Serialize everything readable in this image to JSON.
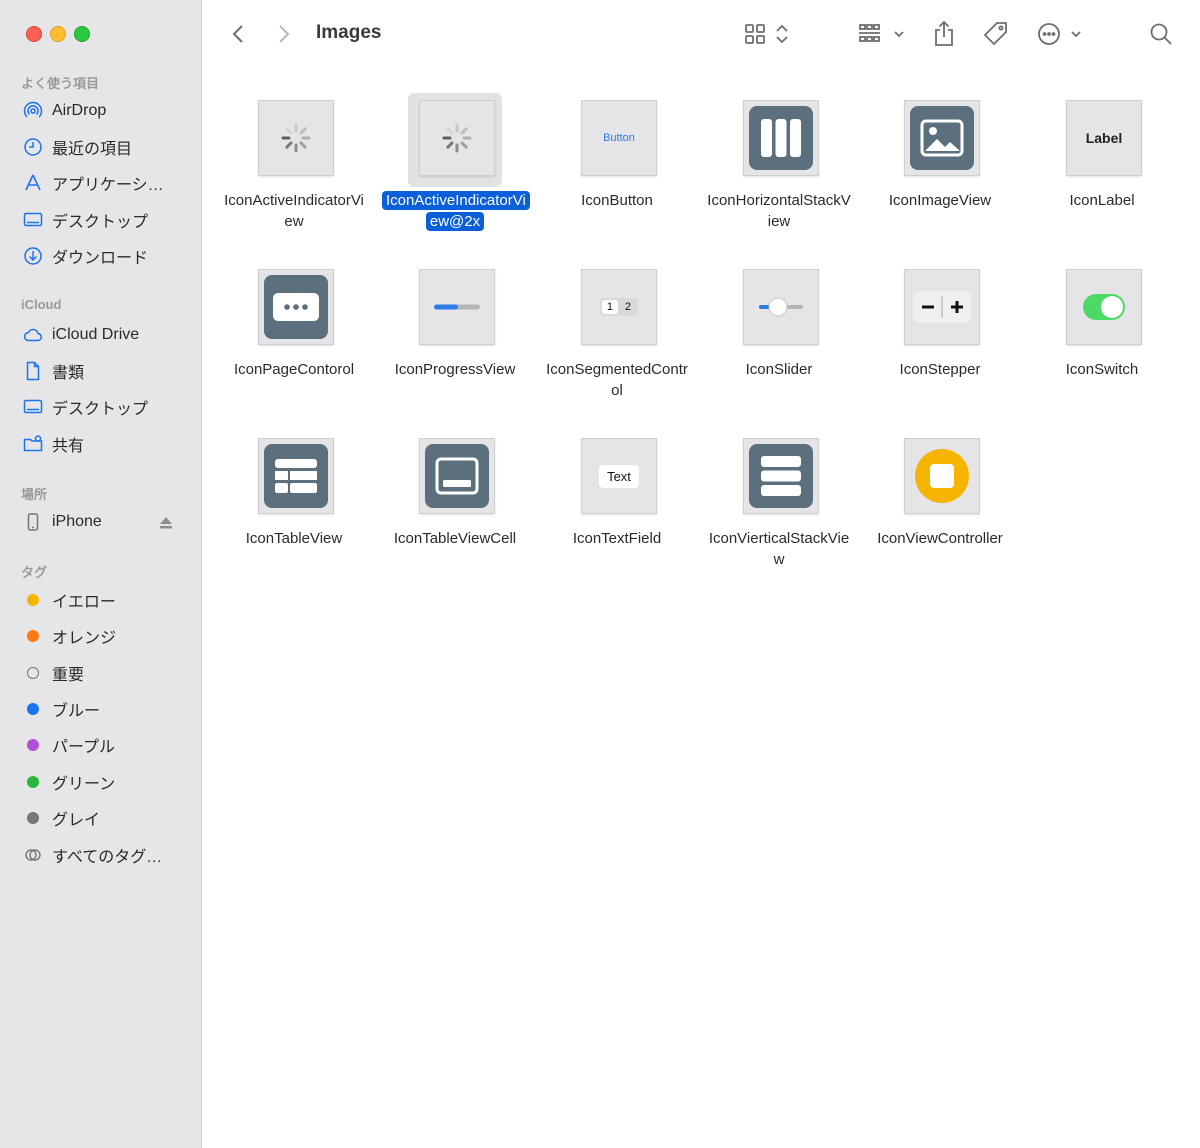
{
  "window": {
    "title": "Images"
  },
  "sidebar": {
    "favorites_header": "よく使う項目",
    "favorites": [
      {
        "label": "AirDrop",
        "icon": "airdrop-icon"
      },
      {
        "label": "最近の項目",
        "icon": "clock-icon"
      },
      {
        "label": "アプリケーシ…",
        "icon": "applications-icon"
      },
      {
        "label": "デスクトップ",
        "icon": "desktop-icon"
      },
      {
        "label": "ダウンロード",
        "icon": "download-icon"
      }
    ],
    "icloud_header": "iCloud",
    "icloud": [
      {
        "label": "iCloud Drive",
        "icon": "cloud-icon"
      },
      {
        "label": "書類",
        "icon": "document-icon"
      },
      {
        "label": "デスクトップ",
        "icon": "desktop-icon"
      },
      {
        "label": "共有",
        "icon": "shared-folder-icon"
      }
    ],
    "locations_header": "場所",
    "locations": [
      {
        "label": "iPhone",
        "icon": "iphone-icon"
      }
    ],
    "tags_header": "タグ",
    "tags": [
      {
        "label": "イエロー",
        "color": "#f5b400"
      },
      {
        "label": "オレンジ",
        "color": "#fa7a14"
      },
      {
        "label": "重要",
        "color": "none"
      },
      {
        "label": "ブルー",
        "color": "#1a73ef"
      },
      {
        "label": "パープル",
        "color": "#b24fd6"
      },
      {
        "label": "グリーン",
        "color": "#29b83c"
      },
      {
        "label": "グレイ",
        "color": "#77777b"
      },
      {
        "label": "すべてのタグ…",
        "color": "all"
      }
    ]
  },
  "files": [
    {
      "name": "IconActiveIndicatorView",
      "thumb": "spinner-icon",
      "selected": false
    },
    {
      "name": "IconActiveIndicatorView@2x",
      "thumb": "spinner-icon",
      "selected": true
    },
    {
      "name": "IconButton",
      "thumb": "button-icon",
      "selected": false,
      "text": "Button"
    },
    {
      "name": "IconHorizontalStackView",
      "thumb": "hstack-icon",
      "selected": false
    },
    {
      "name": "IconImageView",
      "thumb": "image-icon",
      "selected": false
    },
    {
      "name": "IconLabel",
      "thumb": "label-icon",
      "selected": false,
      "text": "Label"
    },
    {
      "name": "IconPageContorol",
      "thumb": "page-control-icon",
      "selected": false
    },
    {
      "name": "IconProgressView",
      "thumb": "progress-icon",
      "selected": false
    },
    {
      "name": "IconSegmentedControl",
      "thumb": "segmented-icon",
      "selected": false,
      "seg": [
        "1",
        "2"
      ]
    },
    {
      "name": "IconSlider",
      "thumb": "slider-icon",
      "selected": false
    },
    {
      "name": "IconStepper",
      "thumb": "stepper-icon",
      "selected": false
    },
    {
      "name": "IconSwitch",
      "thumb": "switch-icon",
      "selected": false
    },
    {
      "name": "IconTableView",
      "thumb": "table-icon",
      "selected": false
    },
    {
      "name": "IconTableViewCell",
      "thumb": "table-cell-icon",
      "selected": false
    },
    {
      "name": "IconTextField",
      "thumb": "textfield-icon",
      "selected": false,
      "text": "Text"
    },
    {
      "name": "IconVierticalStackView",
      "thumb": "vstack-icon",
      "selected": false
    },
    {
      "name": "IconViewController",
      "thumb": "viewcontroller-icon",
      "selected": false
    }
  ],
  "colors": {
    "selection": "#0b5fd8",
    "tile": "#5b6f7d",
    "accent_yellow": "#f5b400",
    "switch_green": "#4cd964"
  }
}
